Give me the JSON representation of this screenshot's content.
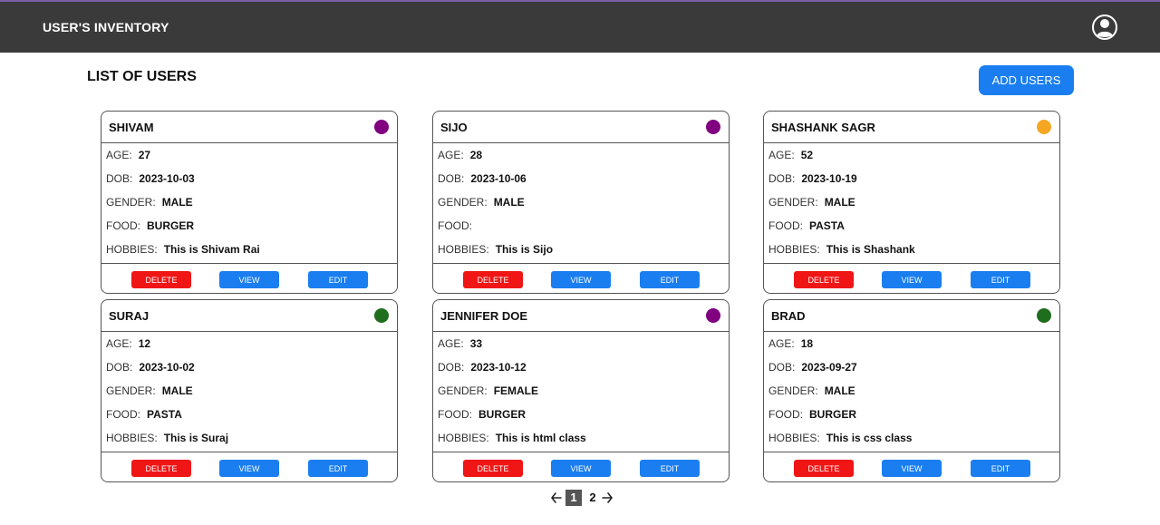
{
  "header": {
    "app_title": "USER'S INVENTORY",
    "profile_icon": "user-circle-icon"
  },
  "main": {
    "page_title": "LIST OF USERS",
    "add_button_label": "ADD USERS"
  },
  "field_labels": {
    "age": "AGE:",
    "dob": "DOB:",
    "gender": "GENDER:",
    "food": "FOOD:",
    "hobbies": "HOBBIES:"
  },
  "button_labels": {
    "delete": "DELETE",
    "view": "VIEW",
    "edit": "EDIT"
  },
  "users": [
    {
      "name": "SHIVAM",
      "status_color": "#800080",
      "age": "27",
      "dob": "2023-10-03",
      "gender": "MALE",
      "food": "BURGER",
      "hobbies": "This is Shivam Rai"
    },
    {
      "name": "SIJO",
      "status_color": "#800080",
      "age": "28",
      "dob": "2023-10-06",
      "gender": "MALE",
      "food": "",
      "hobbies": "This is Sijo"
    },
    {
      "name": "SHASHANK SAGR",
      "status_color": "#f5a623",
      "age": "52",
      "dob": "2023-10-19",
      "gender": "MALE",
      "food": "PASTA",
      "hobbies": "This is Shashank"
    },
    {
      "name": "SURAJ",
      "status_color": "#1e6e1e",
      "age": "12",
      "dob": "2023-10-02",
      "gender": "MALE",
      "food": "PASTA",
      "hobbies": "This is Suraj"
    },
    {
      "name": "JENNIFER DOE",
      "status_color": "#800080",
      "age": "33",
      "dob": "2023-10-12",
      "gender": "FEMALE",
      "food": "BURGER",
      "hobbies": "This is html class"
    },
    {
      "name": "BRAD",
      "status_color": "#1e6e1e",
      "age": "18",
      "dob": "2023-09-27",
      "gender": "MALE",
      "food": "BURGER",
      "hobbies": "This is css class"
    }
  ],
  "pagination": {
    "prev_icon": "arrow-left-icon",
    "next_icon": "arrow-right-icon",
    "pages": [
      "1",
      "2"
    ],
    "current": "1"
  },
  "colors": {
    "topbar": "#3a3a3a",
    "primary": "#1a7ef0",
    "danger": "#f01616"
  }
}
